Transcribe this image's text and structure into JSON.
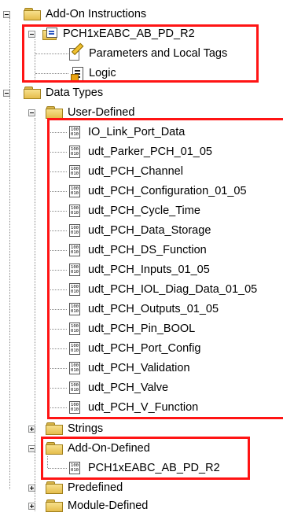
{
  "tree": {
    "add_on_instructions": {
      "label": "Add-On Instructions",
      "instruction": {
        "label": "PCH1xEABC_AB_PD_R2",
        "children": [
          "Parameters and Local Tags",
          "Logic"
        ]
      }
    },
    "data_types": {
      "label": "Data Types",
      "user_defined": {
        "label": "User-Defined",
        "items": [
          "IO_Link_Port_Data",
          "udt_Parker_PCH_01_05",
          "udt_PCH_Channel",
          "udt_PCH_Configuration_01_05",
          "udt_PCH_Cycle_Time",
          "udt_PCH_Data_Storage",
          "udt_PCH_DS_Function",
          "udt_PCH_Inputs_01_05",
          "udt_PCH_IOL_Diag_Data_01_05",
          "udt_PCH_Outputs_01_05",
          "udt_PCH_Pin_BOOL",
          "udt_PCH_Port_Config",
          "udt_PCH_Validation",
          "udt_PCH_Valve",
          "udt_PCH_V_Function"
        ]
      },
      "strings": {
        "label": "Strings"
      },
      "add_on_defined": {
        "label": "Add-On-Defined",
        "items": [
          "PCH1xEABC_AB_PD_R2"
        ]
      },
      "predefined": {
        "label": "Predefined"
      },
      "module_defined": {
        "label": "Module-Defined"
      }
    }
  },
  "udt_icon_text": "100\n010",
  "highlight_color": "#ff1414"
}
